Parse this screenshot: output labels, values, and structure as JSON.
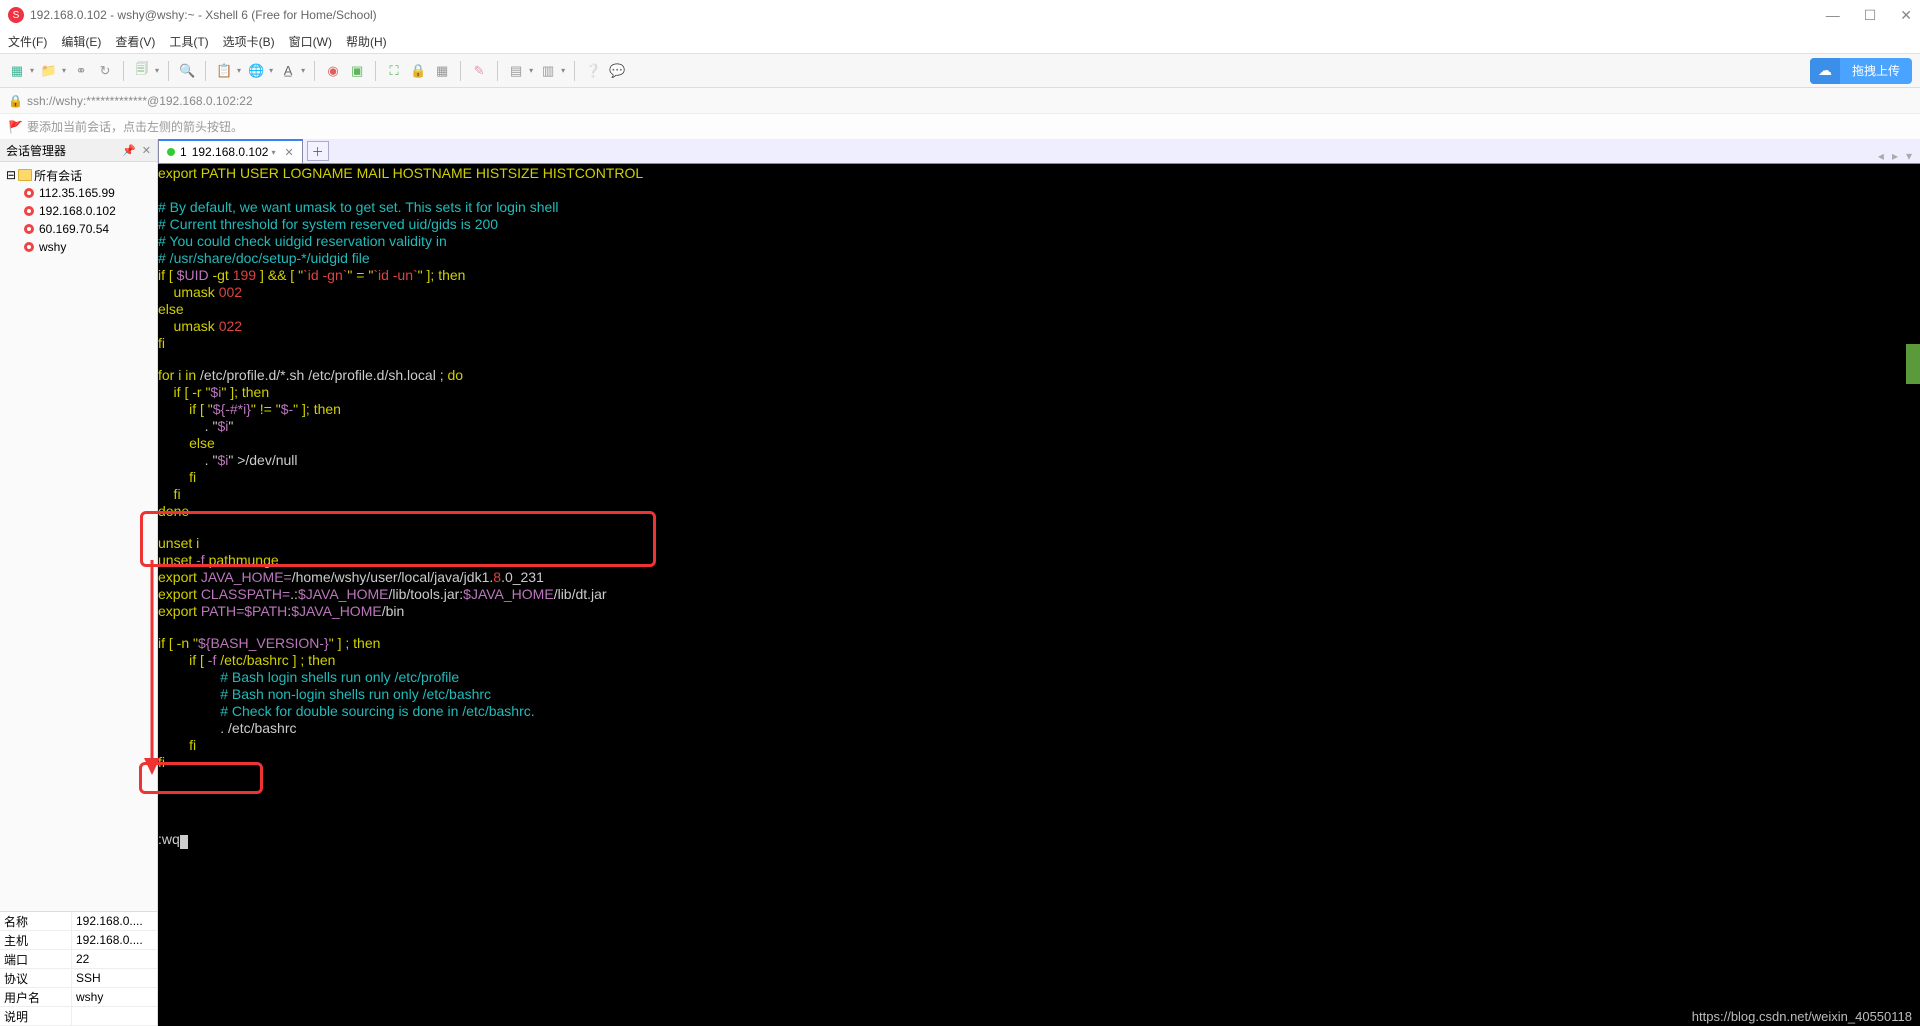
{
  "title": "192.168.0.102 - wshy@wshy:~ - Xshell 6 (Free for Home/School)",
  "menu": [
    "文件(F)",
    "编辑(E)",
    "查看(V)",
    "工具(T)",
    "选项卡(B)",
    "窗口(W)",
    "帮助(H)"
  ],
  "upload_label": "拖拽上传",
  "addr": "ssh://wshy:*************@192.168.0.102:22",
  "hint": "要添加当前会话，点击左侧的箭头按钮。",
  "side_header": "会话管理器",
  "tree_root": "所有会话",
  "tree_items": [
    "112.35.165.99",
    "192.168.0.102",
    "60.169.70.54",
    "wshy"
  ],
  "props": {
    "name_k": "名称",
    "name_v": "192.168.0....",
    "host_k": "主机",
    "host_v": "192.168.0....",
    "port_k": "端口",
    "port_v": "22",
    "proto_k": "协议",
    "proto_v": "SSH",
    "user_k": "用户名",
    "user_v": "wshy",
    "desc_k": "说明",
    "desc_v": ""
  },
  "tab": {
    "num": "1",
    "label": "192.168.0.102"
  },
  "vim_cmd": ":wq",
  "watermark": "https://blog.csdn.net/weixin_40550118",
  "term": {
    "l1": "export PATH USER LOGNAME MAIL HOSTNAME HISTSIZE HISTCONTROL",
    "l2": "",
    "c1": "# By default, we want umask to get set. This sets it for login shell",
    "c2": "# Current threshold for system reserved uid/gids is 200",
    "c3": "# You could check uidgid reservation validity in",
    "c4": "# /usr/share/doc/setup-*/uidgid file",
    "if1a": "if [ ",
    "uid": "$UID",
    "if1b": " -gt ",
    "n199": "199",
    "if1c": " ] && [ \"",
    "idgn": "`id -gn`",
    "if1d": "\" = \"",
    "idun": "`id -un`",
    "if1e": "\" ]; then",
    "um1a": "    umask ",
    "n002": "002",
    "else": "else",
    "um2a": "    umask ",
    "n022": "022",
    "fi": "fi",
    "for1a": "for i ",
    "for1b": "in",
    " for1c": " /etc/profile.d/*.sh /etc/profile.d/sh.local ; ",
    "for1d": "do",
    "ifr1": "    if [ -r \"",
    "si": "$i",
    "ifr2": "\" ]; then",
    "ifx1": "        if [ \"",
    "shx": "${-#*i}",
    "ifx2": "\" != \"",
    "sd": "$-",
    "ifx3": "\" ]; then",
    "dot1": "            . \"",
    "dot2": "\"",
    "else2": "        else",
    "dev1": "            . \"",
    "dev2": "\" >/dev/null",
    "fi2": "        fi",
    "fi3": "    fi",
    "done": "done",
    "unset1": "unset i",
    "unset2a": "unset ",
    "unset2b": "-f",
    " unset2c": " pathmunge",
    "exp1a": "export ",
    "jh": "JAVA_HOME=",
    "exp1b": "/home/wshy/user/local/java/jdk1.",
    "eight": "8",
    "exp1c": ".0_231",
    "exp2a": "export ",
    "cp": "CLASSPATH=",
    "exp2b": ".:",
    "jh2": "$JAVA_HOME",
    "exp2c": "/lib/tools.jar:",
    "jh3": "$JAVA_HOME",
    "exp2d": "/lib/dt.jar",
    "exp3a": "export ",
    "pth": "PATH=",
    "pthv": "$PATH",
    "colon": ":",
    "jh4": "$JAVA_HOME",
    "exp3b": "/bin",
    "ifn1": "if [ -n \"",
    "bv": "${BASH_VERSION-}",
    "ifn2": "\" ] ; then",
    "iff1": "        if [ ",
    "ff": "-f",
    " iff2": " /etc/bashrc ] ; then",
    "bc1": "                # Bash login shells run only /etc/profile",
    "bc2": "                # Bash non-login shells run only /etc/bashrc",
    "bc3": "                # Check for double sourcing is done in /etc/bashrc.",
    "src": "                . /etc/bashrc",
    "fi4": "        fi",
    "fi5": "fi"
  }
}
